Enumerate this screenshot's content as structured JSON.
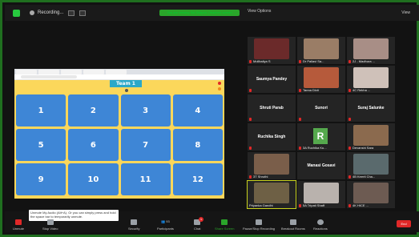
{
  "topbar": {
    "recording_label": "Recording...",
    "share_banner": "You are viewing Sai Shilpa's (Teacher) screen",
    "view_options": "View Options",
    "view_label": "View"
  },
  "shared_screen": {
    "team_label": "Team 1",
    "tiles": [
      "1",
      "2",
      "3",
      "4",
      "5",
      "6",
      "7",
      "8",
      "9",
      "10",
      "11",
      "12"
    ]
  },
  "participants": [
    {
      "name": "Mollbaliya S",
      "kind": "video",
      "color": "#6b2a2a",
      "mic_muted": true
    },
    {
      "name": "Dr Pallavi Sa...",
      "kind": "video",
      "color": "#9a7d66",
      "mic_muted": true
    },
    {
      "name": "2J - Madhura ...",
      "kind": "video",
      "color": "#a88e86",
      "mic_muted": true
    },
    {
      "name": "Saumya Pandey",
      "kind": "name",
      "mic_muted": true
    },
    {
      "name": "Tanna Dixit",
      "kind": "video",
      "color": "#b65a3b",
      "mic_muted": true
    },
    {
      "name": "4C Rekha ...",
      "kind": "video",
      "color": "#cfc1b9",
      "mic_muted": true
    },
    {
      "name": "Shruti Parab",
      "kind": "name",
      "mic_muted": true
    },
    {
      "name": "Sunori",
      "kind": "name",
      "mic_muted": true
    },
    {
      "name": "Suraj Salunke",
      "kind": "name",
      "mic_muted": true
    },
    {
      "name": "Ruchika Singh",
      "kind": "name",
      "mic_muted": true
    },
    {
      "name": "3A Ruchika Ku...",
      "kind": "avatar",
      "avatar_letter": "R",
      "mic_muted": true
    },
    {
      "name": "Devanshi Sara",
      "kind": "video",
      "color": "#8b6a4e",
      "mic_muted": true
    },
    {
      "name": "3T Shruthi",
      "kind": "video",
      "color": "#7a5e4a",
      "mic_muted": true
    },
    {
      "name": "Manasi Gosavi",
      "kind": "name",
      "mic_muted": false
    },
    {
      "name": "4B Keerti Cha...",
      "kind": "video",
      "color": "#5a6a6d",
      "mic_muted": true
    },
    {
      "name": "Priyanka Gandhi",
      "kind": "video",
      "color": "#6e6045",
      "mic_muted": false,
      "active": true
    },
    {
      "name": "5A Tripati Shaff",
      "kind": "video",
      "color": "#b9b2ad",
      "mic_muted": true
    },
    {
      "name": "4K HICE ...",
      "kind": "video",
      "color": "#6d5b52",
      "mic_muted": true
    }
  ],
  "toolbar": {
    "tooltip": "Unmute My Audio (Alt+A). Or you can simply press and hold the space bar to temporarily unmute.",
    "unmute": "Unmute",
    "stop_video": "Stop Video",
    "security": "Security",
    "participants": "Participants",
    "participants_count": "93",
    "chat": "Chat",
    "chat_badge": "5",
    "share_screen": "Share Screen",
    "record": "Pause/Stop Recording",
    "breakout": "Breakout Rooms",
    "reactions": "Reactions",
    "end": "End"
  },
  "colors": {
    "tile_blue": "#3e86d6",
    "game_bg": "#fbd75b",
    "team_bar": "#2ba8c8",
    "share_green": "#2aa52a",
    "end_red": "#e02828"
  }
}
